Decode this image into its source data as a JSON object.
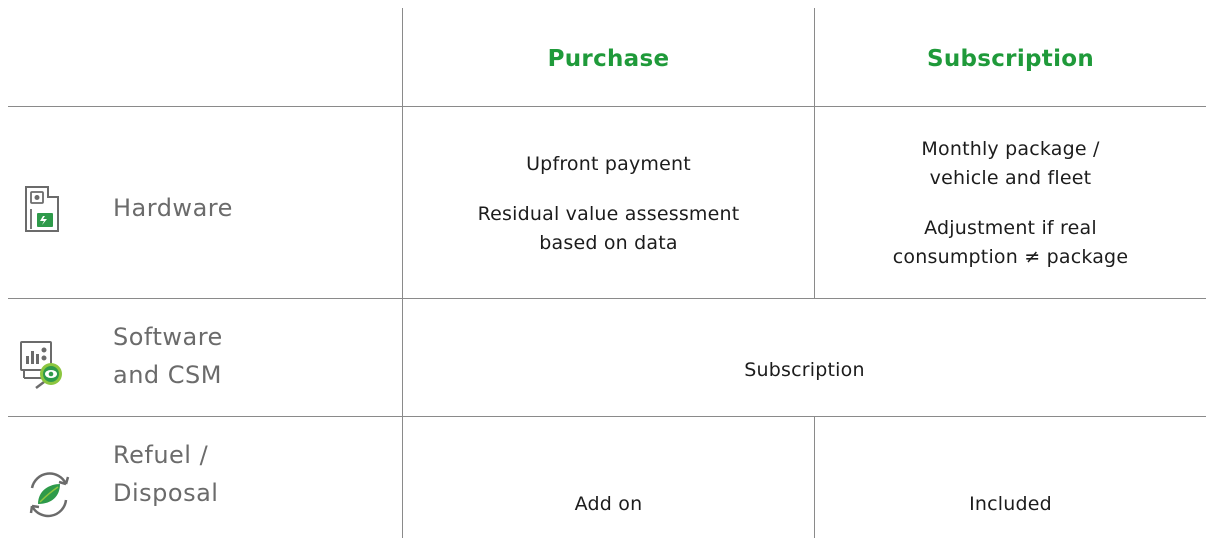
{
  "columns": {
    "purchase": "Purchase",
    "subscription": "Subscription"
  },
  "rows": {
    "hardware": {
      "label": "Hardware",
      "icon": "hardware-device-icon",
      "purchase_line1": "Upfront payment",
      "purchase_line2a": "Residual value assessment",
      "purchase_line2b": "based on data",
      "subscription_line1a": "Monthly package /",
      "subscription_line1b": "vehicle and fleet",
      "subscription_line2a": "Adjustment if real",
      "subscription_line2b": "consumption ≠ package"
    },
    "software": {
      "label_line1": "Software",
      "label_line2": "and CSM",
      "icon": "software-monitoring-icon",
      "merged_value": "Subscription"
    },
    "refuel": {
      "label_line1": "Refuel /",
      "label_line2": "Disposal",
      "icon": "refuel-cycle-icon",
      "purchase": "Add on",
      "subscription": "Included"
    }
  },
  "colors": {
    "header_green": "#1f9a3a",
    "label_grey": "#6b6b6b",
    "grid_line": "#8a8a8a"
  }
}
